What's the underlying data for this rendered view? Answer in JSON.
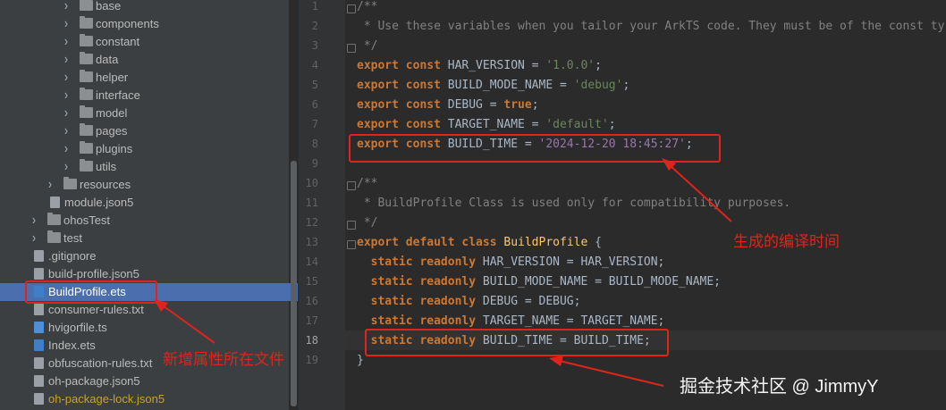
{
  "tree": {
    "items": [
      {
        "label": "base",
        "type": "folder",
        "indent": 3,
        "expandable": true
      },
      {
        "label": "components",
        "type": "folder",
        "indent": 3,
        "expandable": true
      },
      {
        "label": "constant",
        "type": "folder",
        "indent": 3,
        "expandable": true
      },
      {
        "label": "data",
        "type": "folder",
        "indent": 3,
        "expandable": true
      },
      {
        "label": "helper",
        "type": "folder",
        "indent": 3,
        "expandable": true
      },
      {
        "label": "interface",
        "type": "folder",
        "indent": 3,
        "expandable": true
      },
      {
        "label": "model",
        "type": "folder",
        "indent": 3,
        "expandable": true
      },
      {
        "label": "pages",
        "type": "folder",
        "indent": 3,
        "expandable": true
      },
      {
        "label": "plugins",
        "type": "folder",
        "indent": 3,
        "expandable": true
      },
      {
        "label": "utils",
        "type": "folder",
        "indent": 3,
        "expandable": true
      },
      {
        "label": "resources",
        "type": "folder",
        "indent": 2,
        "expandable": true
      },
      {
        "label": "module.json5",
        "type": "file",
        "indent": 2,
        "expandable": false
      },
      {
        "label": "ohosTest",
        "type": "folder",
        "indent": 1,
        "expandable": true
      },
      {
        "label": "test",
        "type": "folder",
        "indent": 1,
        "expandable": true
      },
      {
        "label": ".gitignore",
        "type": "file",
        "indent": 1,
        "expandable": false
      },
      {
        "label": "build-profile.json5",
        "type": "file",
        "indent": 1,
        "expandable": false
      },
      {
        "label": "BuildProfile.ets",
        "type": "ets",
        "indent": 1,
        "expandable": false,
        "selected": true
      },
      {
        "label": "consumer-rules.txt",
        "type": "file",
        "indent": 1,
        "expandable": false
      },
      {
        "label": "hvigorfile.ts",
        "type": "ts",
        "indent": 1,
        "expandable": false
      },
      {
        "label": "Index.ets",
        "type": "ets",
        "indent": 1,
        "expandable": false
      },
      {
        "label": "obfuscation-rules.txt",
        "type": "file",
        "indent": 1,
        "expandable": false
      },
      {
        "label": "oh-package.json5",
        "type": "file",
        "indent": 1,
        "expandable": false
      },
      {
        "label": "oh-package-lock.json5",
        "type": "file",
        "indent": 1,
        "expandable": false,
        "color": "#c9a227"
      }
    ]
  },
  "editor": {
    "current_line": "18",
    "lines": [
      {
        "n": "1",
        "t": [
          [
            "cmt",
            "/**"
          ]
        ]
      },
      {
        "n": "2",
        "t": [
          [
            "cmt",
            " * Use these variables when you tailor your ArkTS code. They must be of the const ty"
          ]
        ]
      },
      {
        "n": "3",
        "t": [
          [
            "cmt",
            " */"
          ]
        ]
      },
      {
        "n": "4",
        "t": [
          [
            "kw",
            "export const "
          ],
          [
            "plain",
            "HAR_VERSION = "
          ],
          [
            "str",
            "'1.0.0'"
          ],
          [
            "plain",
            ";"
          ]
        ]
      },
      {
        "n": "5",
        "t": [
          [
            "kw",
            "export const "
          ],
          [
            "plain",
            "BUILD_MODE_NAME = "
          ],
          [
            "str",
            "'debug'"
          ],
          [
            "plain",
            ";"
          ]
        ]
      },
      {
        "n": "6",
        "t": [
          [
            "kw",
            "export const "
          ],
          [
            "plain",
            "DEBUG = "
          ],
          [
            "kw",
            "true"
          ],
          [
            "plain",
            ";"
          ]
        ]
      },
      {
        "n": "7",
        "t": [
          [
            "kw",
            "export const "
          ],
          [
            "plain",
            "TARGET_NAME = "
          ],
          [
            "str",
            "'default'"
          ],
          [
            "plain",
            ";"
          ]
        ]
      },
      {
        "n": "8",
        "t": [
          [
            "kw",
            "export const "
          ],
          [
            "plain",
            "BUILD_TIME = "
          ],
          [
            "strv",
            "'2024-12-20 18:45:27'"
          ],
          [
            "plain",
            ";"
          ]
        ]
      },
      {
        "n": "9",
        "t": []
      },
      {
        "n": "10",
        "t": [
          [
            "cmt",
            "/**"
          ]
        ]
      },
      {
        "n": "11",
        "t": [
          [
            "cmt",
            " * BuildProfile Class is used only for compatibility purposes."
          ]
        ]
      },
      {
        "n": "12",
        "t": [
          [
            "cmt",
            " */"
          ]
        ]
      },
      {
        "n": "13",
        "t": [
          [
            "kw",
            "export default class "
          ],
          [
            "cls",
            "BuildProfile"
          ],
          [
            "plain",
            " {"
          ]
        ]
      },
      {
        "n": "14",
        "t": [
          [
            "plain",
            "  "
          ],
          [
            "kw",
            "static readonly "
          ],
          [
            "plain",
            "HAR_VERSION = HAR_VERSION;"
          ]
        ]
      },
      {
        "n": "15",
        "t": [
          [
            "plain",
            "  "
          ],
          [
            "kw",
            "static readonly "
          ],
          [
            "plain",
            "BUILD_MODE_NAME = BUILD_MODE_NAME;"
          ]
        ]
      },
      {
        "n": "16",
        "t": [
          [
            "plain",
            "  "
          ],
          [
            "kw",
            "static readonly "
          ],
          [
            "plain",
            "DEBUG = DEBUG;"
          ]
        ]
      },
      {
        "n": "17",
        "t": [
          [
            "plain",
            "  "
          ],
          [
            "kw",
            "static readonly "
          ],
          [
            "plain",
            "TARGET_NAME = TARGET_NAME;"
          ]
        ]
      },
      {
        "n": "18",
        "t": [
          [
            "plain",
            "  "
          ],
          [
            "kw",
            "static readonly "
          ],
          [
            "plain",
            "BUILD_TIME = BUILD_TIME;"
          ]
        ]
      },
      {
        "n": "19",
        "t": [
          [
            "plain",
            "}"
          ]
        ]
      }
    ]
  },
  "annotations": {
    "build_time_label": "生成的编译时间",
    "file_label": "新增属性所在文件",
    "watermark": "掘金技术社区 @ JimmyY"
  },
  "colors": {
    "annotation": "#e0241b",
    "selection": "#4b6eaf"
  }
}
